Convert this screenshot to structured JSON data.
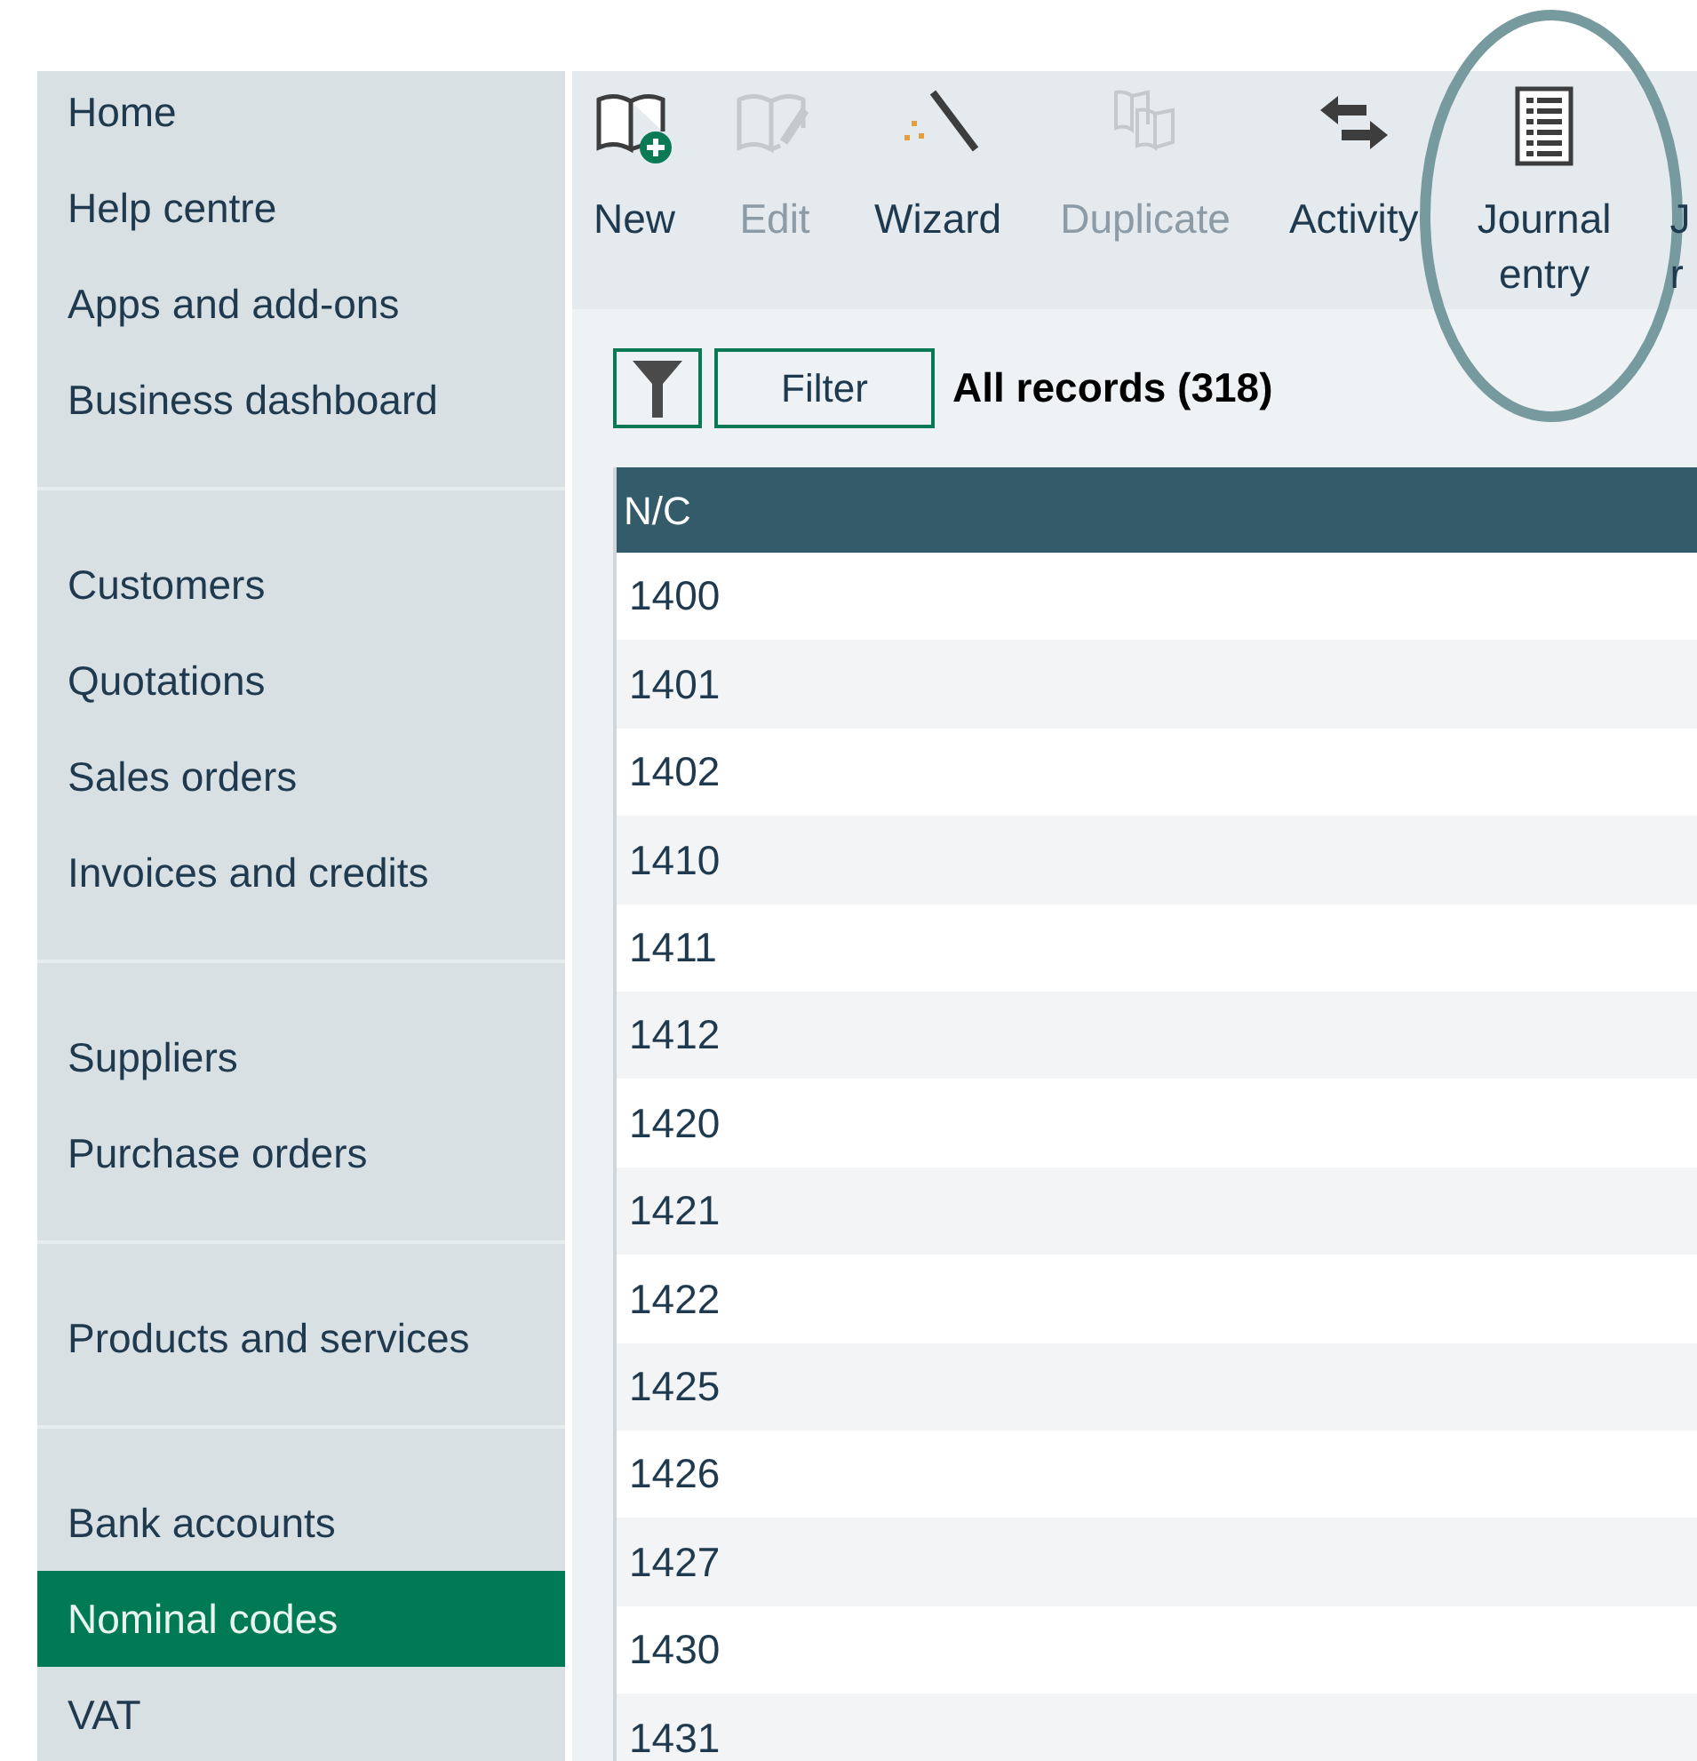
{
  "sidebar": {
    "groups": [
      {
        "items": [
          {
            "label": "Home",
            "selected": false
          },
          {
            "label": "Help centre",
            "selected": false
          },
          {
            "label": "Apps and add-ons",
            "selected": false
          },
          {
            "label": "Business dashboard",
            "selected": false
          }
        ]
      },
      {
        "items": [
          {
            "label": "Customers",
            "selected": false
          },
          {
            "label": "Quotations",
            "selected": false
          },
          {
            "label": "Sales orders",
            "selected": false
          },
          {
            "label": "Invoices and credits",
            "selected": false
          }
        ]
      },
      {
        "items": [
          {
            "label": "Suppliers",
            "selected": false
          },
          {
            "label": "Purchase orders",
            "selected": false
          }
        ]
      },
      {
        "items": [
          {
            "label": "Products and services",
            "selected": false
          }
        ]
      },
      {
        "items": [
          {
            "label": "Bank accounts",
            "selected": false
          },
          {
            "label": "Nominal codes",
            "selected": true
          },
          {
            "label": "VAT",
            "selected": false
          }
        ]
      }
    ]
  },
  "toolbar": [
    {
      "kind": "new",
      "lines": [
        "New"
      ],
      "disabled": false
    },
    {
      "kind": "edit",
      "lines": [
        "Edit"
      ],
      "disabled": true
    },
    {
      "kind": "wizard",
      "lines": [
        "Wizard"
      ],
      "disabled": false
    },
    {
      "kind": "duplicate",
      "lines": [
        "Duplicate"
      ],
      "disabled": true
    },
    {
      "kind": "activity",
      "lines": [
        "Activity"
      ],
      "disabled": false
    },
    {
      "kind": "journal",
      "lines": [
        "Journal",
        "entry"
      ],
      "disabled": false
    },
    {
      "kind": "cut",
      "lines": [
        "J",
        "r"
      ],
      "disabled": false
    }
  ],
  "filter": {
    "button": "Filter",
    "summary": "All records (318)"
  },
  "table": {
    "columns": [
      "N/C"
    ],
    "rows": [
      [
        "1400"
      ],
      [
        "1401"
      ],
      [
        "1402"
      ],
      [
        "1410"
      ],
      [
        "1411"
      ],
      [
        "1412"
      ],
      [
        "1420"
      ],
      [
        "1421"
      ],
      [
        "1422"
      ],
      [
        "1425"
      ],
      [
        "1426"
      ],
      [
        "1427"
      ],
      [
        "1430"
      ],
      [
        "1431"
      ]
    ]
  }
}
